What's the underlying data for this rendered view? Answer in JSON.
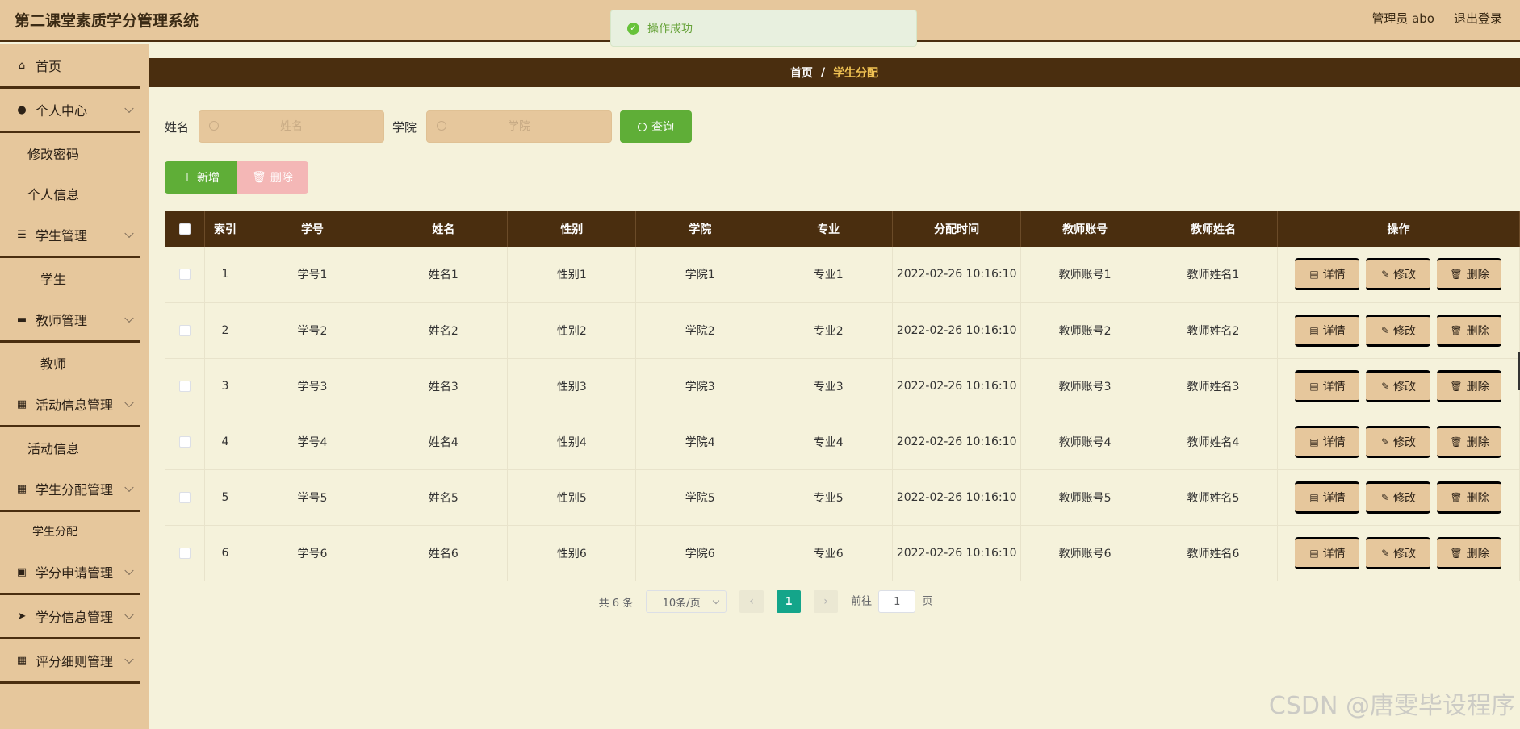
{
  "header": {
    "app_title": "第二课堂素质学分管理系统",
    "user_label": "管理员 abo",
    "logout_label": "退出登录"
  },
  "toast": {
    "message": "操作成功",
    "icon": "check-circle-icon"
  },
  "sidebar": {
    "items": [
      {
        "type": "menu",
        "label": "首页",
        "icon": "home-icon",
        "glyph": "⌂",
        "expandable": false
      },
      {
        "type": "menu",
        "label": "个人中心",
        "icon": "user-icon",
        "glyph": "●",
        "expandable": true
      },
      {
        "type": "sub",
        "label": "修改密码"
      },
      {
        "type": "sub",
        "label": "个人信息"
      },
      {
        "type": "menu",
        "label": "学生管理",
        "icon": "list-icon",
        "glyph": "☰",
        "expandable": true
      },
      {
        "type": "sub",
        "label": "学生",
        "align": "center"
      },
      {
        "type": "menu",
        "label": "教师管理",
        "icon": "chat-icon",
        "glyph": "▬",
        "expandable": true
      },
      {
        "type": "sub",
        "label": "教师",
        "align": "center"
      },
      {
        "type": "menu",
        "label": "活动信息管理",
        "icon": "grid-icon",
        "glyph": "▦",
        "expandable": true
      },
      {
        "type": "sub",
        "label": "活动信息"
      },
      {
        "type": "menu",
        "label": "学生分配管理",
        "icon": "grid-icon",
        "glyph": "▦",
        "expandable": true
      },
      {
        "type": "sub",
        "label": "学生分配",
        "align": "small"
      },
      {
        "type": "menu",
        "label": "学分申请管理",
        "icon": "clipboard-icon",
        "glyph": "▣",
        "expandable": true
      },
      {
        "type": "menu",
        "label": "学分信息管理",
        "icon": "send-icon",
        "glyph": "➤",
        "expandable": true
      },
      {
        "type": "menu",
        "label": "评分细则管理",
        "icon": "grid-icon",
        "glyph": "▦",
        "expandable": true
      }
    ]
  },
  "breadcrumb": {
    "home": "首页",
    "separator": "/",
    "current": "学生分配"
  },
  "search": {
    "name_label": "姓名",
    "name_placeholder": "姓名",
    "college_label": "学院",
    "college_placeholder": "学院",
    "query_label": "查询"
  },
  "actions": {
    "add_label": "新增",
    "delete_label": "删除"
  },
  "table": {
    "columns": [
      "索引",
      "学号",
      "姓名",
      "性别",
      "学院",
      "专业",
      "分配时间",
      "教师账号",
      "教师姓名",
      "操作"
    ],
    "rows": [
      [
        "1",
        "学号1",
        "姓名1",
        "性别1",
        "学院1",
        "专业1",
        "2022-02-26 10:16:10",
        "教师账号1",
        "教师姓名1"
      ],
      [
        "2",
        "学号2",
        "姓名2",
        "性别2",
        "学院2",
        "专业2",
        "2022-02-26 10:16:10",
        "教师账号2",
        "教师姓名2"
      ],
      [
        "3",
        "学号3",
        "姓名3",
        "性别3",
        "学院3",
        "专业3",
        "2022-02-26 10:16:10",
        "教师账号3",
        "教师姓名3"
      ],
      [
        "4",
        "学号4",
        "姓名4",
        "性别4",
        "学院4",
        "专业4",
        "2022-02-26 10:16:10",
        "教师账号4",
        "教师姓名4"
      ],
      [
        "5",
        "学号5",
        "姓名5",
        "性别5",
        "学院5",
        "专业5",
        "2022-02-26 10:16:10",
        "教师账号5",
        "教师姓名5"
      ],
      [
        "6",
        "学号6",
        "姓名6",
        "性别6",
        "学院6",
        "专业6",
        "2022-02-26 10:16:10",
        "教师账号6",
        "教师姓名6"
      ]
    ],
    "row_actions": {
      "detail": "详情",
      "edit": "修改",
      "delete": "删除"
    }
  },
  "pagination": {
    "total_text": "共 6 条",
    "page_size": "10条/页",
    "current_page": "1",
    "goto_label": "前往",
    "goto_value": "1",
    "page_suffix": "页"
  },
  "watermark": "CSDN @唐雯毕设程序",
  "colors": {
    "header_bg": "#e6c79c",
    "dark_brown": "#4a2e0f",
    "page_bg": "#f5f2db",
    "green": "#5fae37",
    "pink": "#f4b7b6",
    "teal": "#14a58a",
    "crumb_current": "#f0c253"
  }
}
